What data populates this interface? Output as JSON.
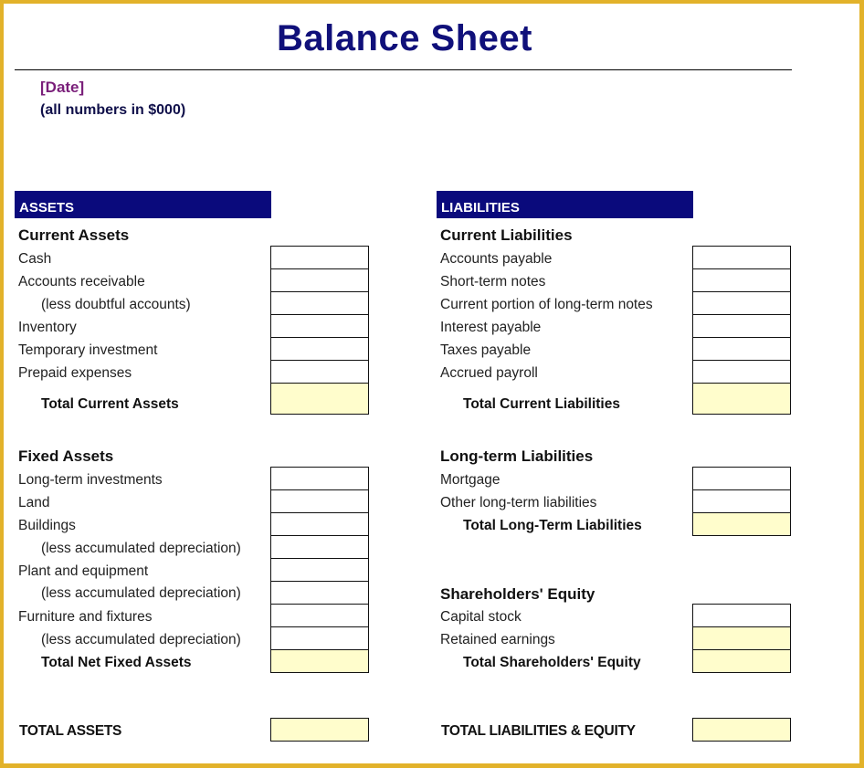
{
  "header": {
    "title": "Balance Sheet",
    "date_placeholder": "[Date]",
    "units_note": "(all numbers in $000)"
  },
  "colors": {
    "frame": "#e2b22a",
    "banner": "#0a0a7c",
    "title": "#10107a",
    "date": "#7a1f7a",
    "total_cell": "#fffdcc"
  },
  "assets": {
    "banner": "ASSETS",
    "current": {
      "heading": "Current Assets",
      "items": [
        {
          "label": "Cash",
          "value": ""
        },
        {
          "label": "Accounts receivable",
          "value": ""
        },
        {
          "label": "(less doubtful accounts)",
          "value": ""
        },
        {
          "label": "Inventory",
          "value": ""
        },
        {
          "label": "Temporary investment",
          "value": ""
        },
        {
          "label": "Prepaid expenses",
          "value": ""
        }
      ],
      "total_label": "Total Current Assets",
      "total_value": ""
    },
    "fixed": {
      "heading": "Fixed Assets",
      "items": [
        {
          "label": "Long-term investments",
          "value": ""
        },
        {
          "label": "Land",
          "value": ""
        },
        {
          "label": "Buildings",
          "value": ""
        },
        {
          "label": "(less accumulated depreciation)",
          "value": ""
        },
        {
          "label": "Plant and equipment",
          "value": ""
        },
        {
          "label": "(less accumulated depreciation)",
          "value": ""
        },
        {
          "label": "Furniture and fixtures",
          "value": ""
        },
        {
          "label": "(less accumulated depreciation)",
          "value": ""
        }
      ],
      "total_label": "Total Net Fixed Assets",
      "total_value": ""
    },
    "grand_total_label": "TOTAL ASSETS",
    "grand_total_value": ""
  },
  "liabilities": {
    "banner": "LIABILITIES",
    "current": {
      "heading": "Current Liabilities",
      "items": [
        {
          "label": "Accounts payable",
          "value": ""
        },
        {
          "label": "Short-term notes",
          "value": ""
        },
        {
          "label": "Current portion of long-term notes",
          "value": ""
        },
        {
          "label": "Interest payable",
          "value": ""
        },
        {
          "label": "Taxes payable",
          "value": ""
        },
        {
          "label": "Accrued payroll",
          "value": ""
        }
      ],
      "total_label": "Total Current Liabilities",
      "total_value": ""
    },
    "long_term": {
      "heading": "Long-term Liabilities",
      "items": [
        {
          "label": "Mortgage",
          "value": ""
        },
        {
          "label": "Other long-term liabilities",
          "value": ""
        }
      ],
      "total_label": "Total Long-Term Liabilities",
      "total_value": ""
    },
    "equity": {
      "heading": "Shareholders' Equity",
      "items": [
        {
          "label": "Capital stock",
          "value": ""
        },
        {
          "label": "Retained earnings",
          "value": ""
        }
      ],
      "total_label": "Total Shareholders' Equity",
      "total_value": ""
    },
    "grand_total_label": "TOTAL LIABILITIES & EQUITY",
    "grand_total_value": ""
  }
}
